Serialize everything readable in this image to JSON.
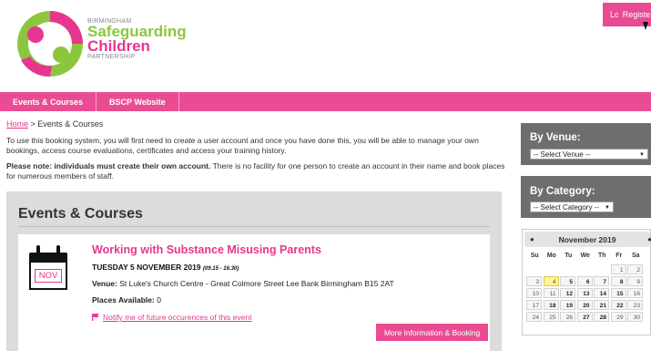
{
  "header": {
    "brand_small_top": "BIRMINGHAM",
    "brand_line1": "Safeguarding",
    "brand_line2": "Children",
    "brand_small_bottom": "PARTNERSHIP",
    "login_label": "Login",
    "register_label": "Registe"
  },
  "nav": {
    "items": [
      {
        "label": "Events & Courses"
      },
      {
        "label": "BSCP Website"
      }
    ]
  },
  "main": {
    "breadcrumb_home": "Home",
    "breadcrumb_rest": " > Events & Courses",
    "intro": "To use this booking system, you will first need to create a user account and once you have done this, you will be able to manage your own bookings, access course evaluations, certificates and access your training history.",
    "note_bold": "Please note: individuals must create their own account.",
    "note_rest": " There is no facility for one person to create an account in their name and book places for numerous members of staff."
  },
  "events": {
    "title": "Events & Courses",
    "event": {
      "month": "NOV",
      "title": "Working with Substance Misusing Parents",
      "date": "TUESDAY 5 NOVEMBER 2019",
      "time": "(09.15 - 16.30)",
      "venue_label": "Venue:",
      "venue": " St Luke's Church Centre - Great Colmore Street Lee Bank Birmingham B15 2AT",
      "places_label": "Places Available:",
      "places": " 0",
      "notify": "Notify me of future occurences of this event",
      "more_button": "More Information & Booking"
    }
  },
  "sidebar": {
    "venue_title": "By Venue:",
    "venue_select": "-- Select Venue --",
    "category_title": "By Category:",
    "category_select": "-- Select Category --"
  },
  "calendar": {
    "month": "November 2019",
    "dow": [
      "Su",
      "Mo",
      "Tu",
      "We",
      "Th",
      "Fr",
      "Sa"
    ],
    "weeks": [
      [
        "",
        "",
        "",
        "",
        "",
        "1",
        "2"
      ],
      [
        "3",
        "4",
        "5",
        "6",
        "7",
        "8",
        "9"
      ],
      [
        "10",
        "11",
        "12",
        "13",
        "14",
        "15",
        "16"
      ],
      [
        "17",
        "18",
        "19",
        "20",
        "21",
        "22",
        "23"
      ],
      [
        "24",
        "25",
        "26",
        "27",
        "28",
        "29",
        "30"
      ]
    ]
  },
  "colors": {
    "pink": "#e94b93",
    "green": "#8cc63f",
    "sidebar_grey": "#6d6f6f"
  }
}
